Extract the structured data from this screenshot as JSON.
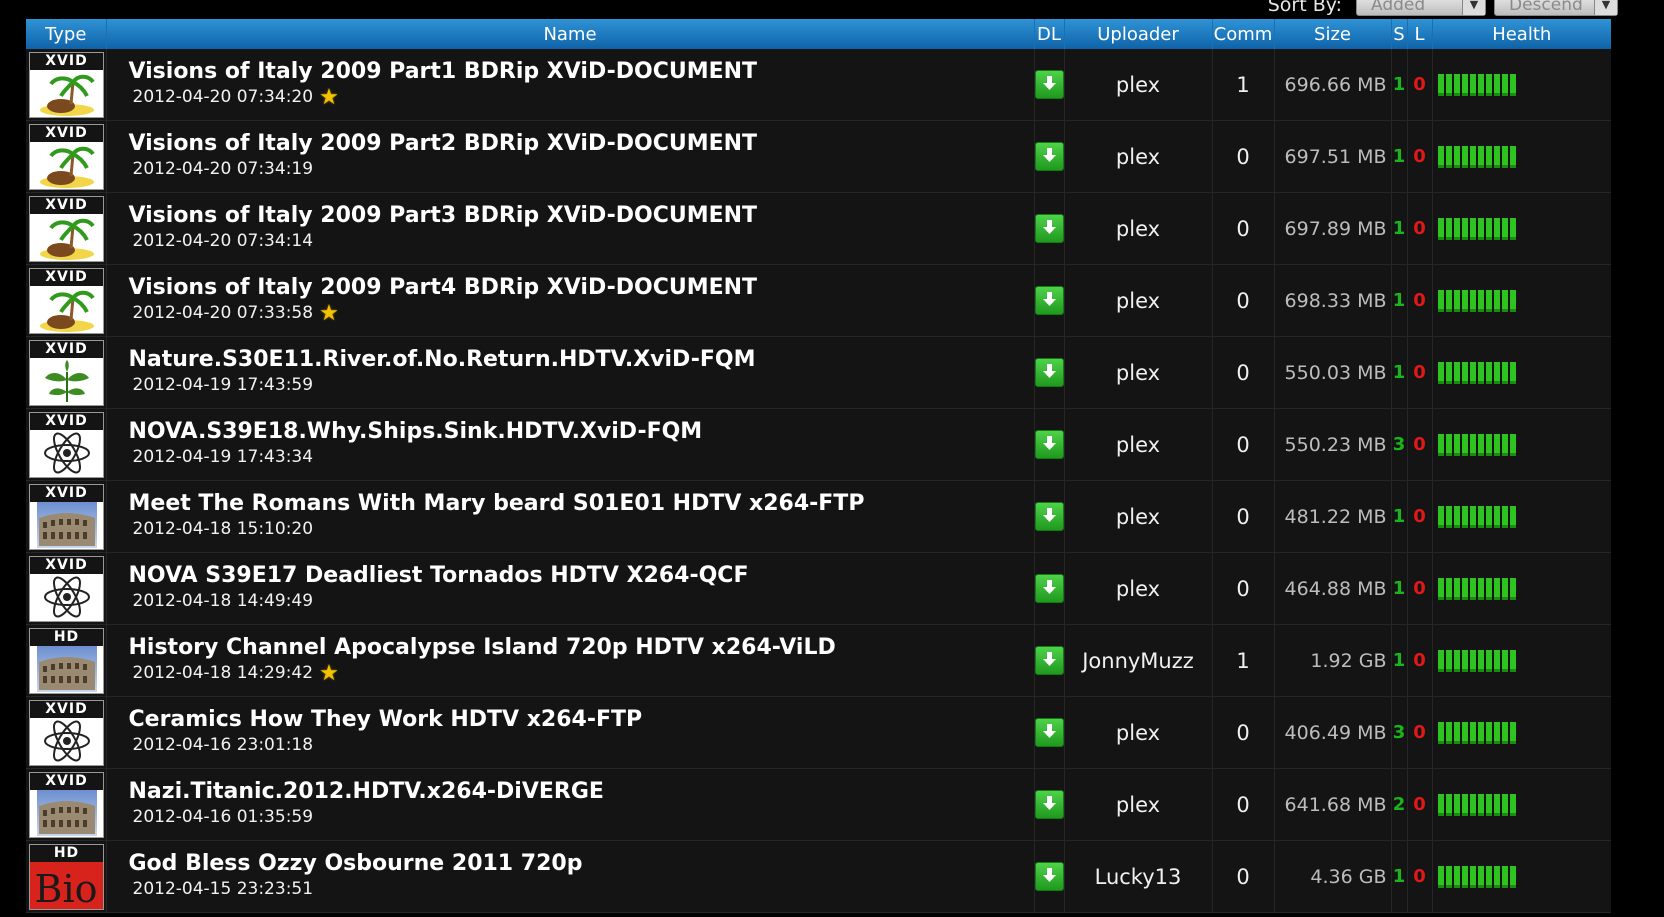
{
  "sort": {
    "label": "Sort By:",
    "sort_field": "Added",
    "sort_order": "Descend"
  },
  "columns": {
    "type": "Type",
    "name": "Name",
    "dl": "DL",
    "uploader": "Uploader",
    "comm": "Comm",
    "size": "Size",
    "s": "S",
    "l": "L",
    "health": "Health"
  },
  "rows": [
    {
      "badge": "XVID",
      "category_icon": "palm-island-icon",
      "name": "Visions of Italy 2009 Part1 BDRip XViD-DOCUMENT",
      "date": "2012-04-20 07:34:20",
      "starred": true,
      "uploader": "plex",
      "comments": "1",
      "size": "696.66 MB",
      "seeders": "1",
      "leechers": "0",
      "health_level": 1.0
    },
    {
      "badge": "XVID",
      "category_icon": "palm-island-icon",
      "name": "Visions of Italy 2009 Part2 BDRip XViD-DOCUMENT",
      "date": "2012-04-20 07:34:19",
      "starred": false,
      "uploader": "plex",
      "comments": "0",
      "size": "697.51 MB",
      "seeders": "1",
      "leechers": "0",
      "health_level": 1.0
    },
    {
      "badge": "XVID",
      "category_icon": "palm-island-icon",
      "name": "Visions of Italy 2009 Part3 BDRip XViD-DOCUMENT",
      "date": "2012-04-20 07:34:14",
      "starred": false,
      "uploader": "plex",
      "comments": "0",
      "size": "697.89 MB",
      "seeders": "1",
      "leechers": "0",
      "health_level": 1.0
    },
    {
      "badge": "XVID",
      "category_icon": "palm-island-icon",
      "name": "Visions of Italy 2009 Part4 BDRip XViD-DOCUMENT",
      "date": "2012-04-20 07:33:58",
      "starred": true,
      "uploader": "plex",
      "comments": "0",
      "size": "698.33 MB",
      "seeders": "1",
      "leechers": "0",
      "health_level": 1.0
    },
    {
      "badge": "XVID",
      "category_icon": "plant-icon",
      "name": "Nature.S30E11.River.of.No.Return.HDTV.XviD-FQM",
      "date": "2012-04-19 17:43:59",
      "starred": false,
      "uploader": "plex",
      "comments": "0",
      "size": "550.03 MB",
      "seeders": "1",
      "leechers": "0",
      "health_level": 1.0
    },
    {
      "badge": "XVID",
      "category_icon": "atom-icon",
      "name": "NOVA.S39E18.Why.Ships.Sink.HDTV.XviD-FQM",
      "date": "2012-04-19 17:43:34",
      "starred": false,
      "uploader": "plex",
      "comments": "0",
      "size": "550.23 MB",
      "seeders": "3",
      "leechers": "0",
      "health_level": 1.0
    },
    {
      "badge": "XVID",
      "category_icon": "colosseum-icon",
      "name": "Meet The Romans With Mary beard S01E01 HDTV x264-FTP",
      "date": "2012-04-18 15:10:20",
      "starred": false,
      "uploader": "plex",
      "comments": "0",
      "size": "481.22 MB",
      "seeders": "1",
      "leechers": "0",
      "health_level": 1.0
    },
    {
      "badge": "XVID",
      "category_icon": "atom-icon",
      "name": "NOVA S39E17 Deadliest Tornados HDTV X264-QCF",
      "date": "2012-04-18 14:49:49",
      "starred": false,
      "uploader": "plex",
      "comments": "0",
      "size": "464.88 MB",
      "seeders": "1",
      "leechers": "0",
      "health_level": 1.0
    },
    {
      "badge": "HD",
      "category_icon": "colosseum-icon",
      "name": "History Channel Apocalypse Island 720p HDTV x264-ViLD",
      "date": "2012-04-18 14:29:42",
      "starred": true,
      "uploader": "JonnyMuzz",
      "comments": "1",
      "size": "1.92 GB",
      "seeders": "1",
      "leechers": "0",
      "health_level": 1.0
    },
    {
      "badge": "XVID",
      "category_icon": "atom-icon",
      "name": "Ceramics How They Work HDTV x264-FTP",
      "date": "2012-04-16 23:01:18",
      "starred": false,
      "uploader": "plex",
      "comments": "0",
      "size": "406.49 MB",
      "seeders": "3",
      "leechers": "0",
      "health_level": 1.0
    },
    {
      "badge": "XVID",
      "category_icon": "colosseum-icon",
      "name": "Nazi.Titanic.2012.HDTV.x264-DiVERGE",
      "date": "2012-04-16 01:35:59",
      "starred": false,
      "uploader": "plex",
      "comments": "0",
      "size": "641.68 MB",
      "seeders": "2",
      "leechers": "0",
      "health_level": 1.0
    },
    {
      "badge": "HD",
      "category_icon": "bio-logo-icon",
      "name": "God Bless Ozzy Osbourne 2011 720p",
      "date": "2012-04-15 23:23:51",
      "starred": false,
      "uploader": "Lucky13",
      "comments": "0",
      "size": "4.36 GB",
      "seeders": "1",
      "leechers": "0",
      "health_level": 1.0
    }
  ],
  "bio_logo_text": "Bio",
  "colors": {
    "header_blue": "#1a7cc4",
    "seeders_green": "#19b51b",
    "leechers_red": "#e01818",
    "health_green": "#2ec41f",
    "star_yellow": "#f2c200"
  }
}
